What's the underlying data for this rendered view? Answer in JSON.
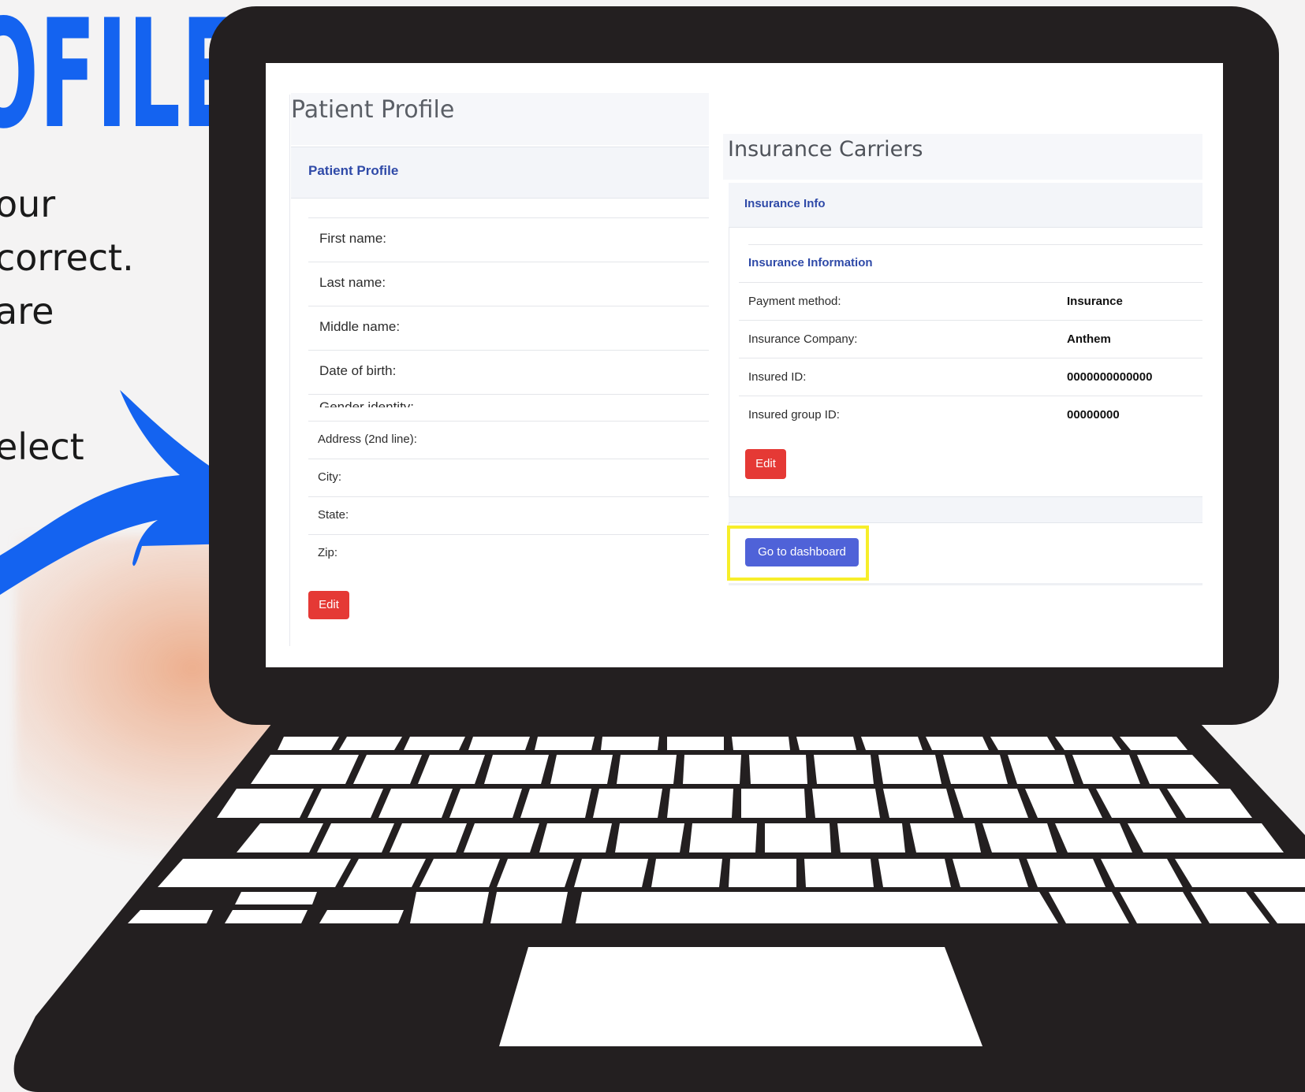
{
  "poster": {
    "headline_fragment": "OFILE",
    "instruction_lines": [
      "our",
      "correct.",
      "are",
      "elect"
    ],
    "arrow_color": "#1463f0",
    "headline_color": "#1463f0"
  },
  "patient_profile": {
    "page_title": "Patient Profile",
    "card_header": "Patient Profile",
    "fields": [
      "First name:",
      "Last name:",
      "Middle name:",
      "Date of birth:"
    ],
    "clipped_field": "Gender identity:",
    "address_fields": [
      "Address (2nd line):",
      "City:",
      "State:",
      "Zip:"
    ],
    "edit_label": "Edit"
  },
  "insurance": {
    "page_title": "Insurance Carriers",
    "card_header": "Insurance Info",
    "section_title": "Insurance Information",
    "rows": [
      {
        "label": "Payment method:",
        "value": "Insurance"
      },
      {
        "label": "Insurance Company:",
        "value": "Anthem"
      },
      {
        "label": "Insured ID:",
        "value": "0000000000000"
      },
      {
        "label": "Insured group ID:",
        "value": "00000000"
      }
    ],
    "edit_label": "Edit",
    "dashboard_label": "Go to dashboard",
    "highlight_color": "#f7ee2a"
  }
}
